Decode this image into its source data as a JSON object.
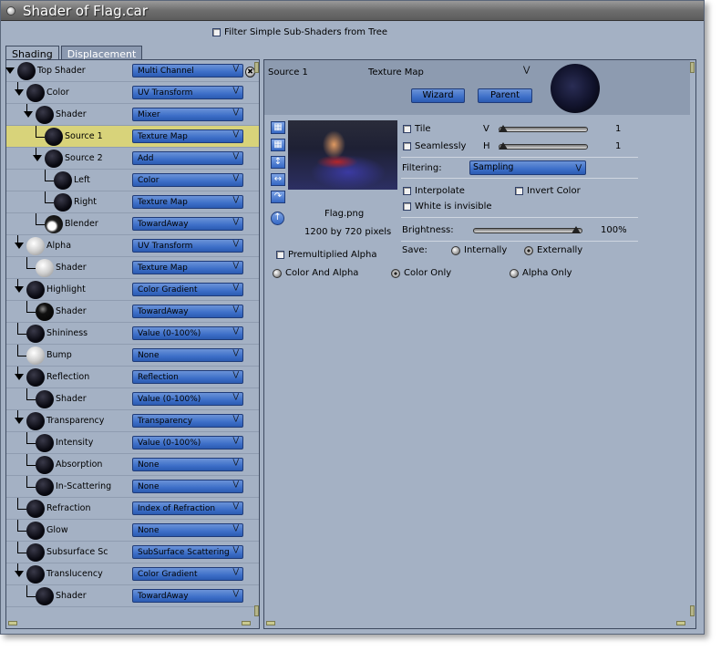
{
  "window": {
    "title": "Shader of Flag.car"
  },
  "filter": {
    "label": "Filter Simple Sub-Shaders from Tree",
    "checked": false
  },
  "tabs": [
    {
      "label": "Shading",
      "active": true
    },
    {
      "label": "Displacement",
      "active": false
    }
  ],
  "tree": [
    {
      "label": "Top Shader",
      "value": "Multi Channel",
      "ball": "dark"
    },
    {
      "label": "Color",
      "value": "UV Transform",
      "ball": "dark"
    },
    {
      "label": "Shader",
      "value": "Mixer",
      "ball": "dark"
    },
    {
      "label": "Source 1",
      "value": "Texture Map",
      "ball": "dark"
    },
    {
      "label": "Source 2",
      "value": "Add",
      "ball": "dark"
    },
    {
      "label": "Left",
      "value": "Color",
      "ball": "dark"
    },
    {
      "label": "Right",
      "value": "Texture Map",
      "ball": "dark"
    },
    {
      "label": "Blender",
      "value": "TowardAway",
      "ball": "blender"
    },
    {
      "label": "Alpha",
      "value": "UV Transform",
      "ball": "white"
    },
    {
      "label": "Shader",
      "value": "Texture Map",
      "ball": "white"
    },
    {
      "label": "Highlight",
      "value": "Color Gradient",
      "ball": "dark"
    },
    {
      "label": "Shader",
      "value": "TowardAway",
      "ball": "shine"
    },
    {
      "label": "Shininess",
      "value": "Value (0-100%)",
      "ball": "dark"
    },
    {
      "label": "Bump",
      "value": "None",
      "ball": "white"
    },
    {
      "label": "Reflection",
      "value": "Reflection",
      "ball": "dark"
    },
    {
      "label": "Shader",
      "value": "Value (0-100%)",
      "ball": "dark"
    },
    {
      "label": "Transparency",
      "value": "Transparency",
      "ball": "dark"
    },
    {
      "label": "Intensity",
      "value": "Value (0-100%)",
      "ball": "dark"
    },
    {
      "label": "Absorption",
      "value": "None",
      "ball": "dark"
    },
    {
      "label": "In-Scattering",
      "value": "None",
      "ball": "dark"
    },
    {
      "label": "Refraction",
      "value": "Index of Refraction",
      "ball": "dark"
    },
    {
      "label": "Glow",
      "value": "None",
      "ball": "dark"
    },
    {
      "label": "Subsurface Sc",
      "value": "SubSurface Scattering",
      "ball": "dark"
    },
    {
      "label": "Translucency",
      "value": "Color Gradient",
      "ball": "dark"
    },
    {
      "label": "Shader",
      "value": "TowardAway",
      "ball": "dark"
    }
  ],
  "selected_row": "Source 1",
  "editor": {
    "source_label": "Source 1",
    "type_label": "Texture Map",
    "wizard_label": "Wizard",
    "parent_label": "Parent",
    "file_name": "Flag.png",
    "dimensions": "1200 by 720 pixels",
    "tile_label": "Tile",
    "seamlessly_label": "Seamlessly",
    "v_label": "V",
    "h_label": "H",
    "v_value": "1",
    "h_value": "1",
    "filtering_label": "Filtering:",
    "filtering_value": "Sampling",
    "interpolate_label": "Interpolate",
    "invert_color_label": "Invert Color",
    "white_invisible_label": "White is invisible",
    "brightness_label": "Brightness:",
    "brightness_value": "100%",
    "save_label": "Save:",
    "internally_label": "Internally",
    "externally_label": "Externally",
    "save_selected": "Externally",
    "premultiplied_label": "Premultiplied Alpha",
    "color_and_alpha_label": "Color And Alpha",
    "color_only_label": "Color Only",
    "alpha_only_label": "Alpha Only",
    "channel_selected": "Color Only"
  },
  "colors": {
    "panel": "#a4b1c4",
    "highlight": "#d8d37a",
    "button": "#3d6fc8"
  }
}
